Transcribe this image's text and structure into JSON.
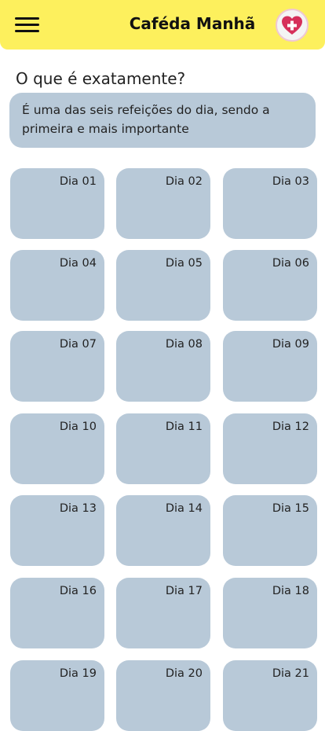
{
  "header": {
    "title": "Caféda Manhã",
    "menu_icon": "hamburger-menu-icon",
    "badge_icon": "heart-plus-icon",
    "background": "#fdf05d",
    "badge_heart_color": "#d6305a"
  },
  "intro": {
    "question": "O que é exatamente?",
    "answer": "É uma das seis refeições do dia, sendo a primeira e mais importante"
  },
  "days": [
    "Dia 01",
    "Dia 02",
    "Dia 03",
    "Dia 04",
    "Dia 05",
    "Dia 06",
    "Dia 07",
    "Dia 08",
    "Dia 09",
    "Dia 10",
    "Dia 11",
    "Dia 12",
    "Dia 13",
    "Dia 14",
    "Dia 15",
    "Dia 16",
    "Dia 17",
    "Dia 18",
    "Dia 19",
    "Dia 20",
    "Dia 21"
  ],
  "card_color": "#b8c9d8"
}
